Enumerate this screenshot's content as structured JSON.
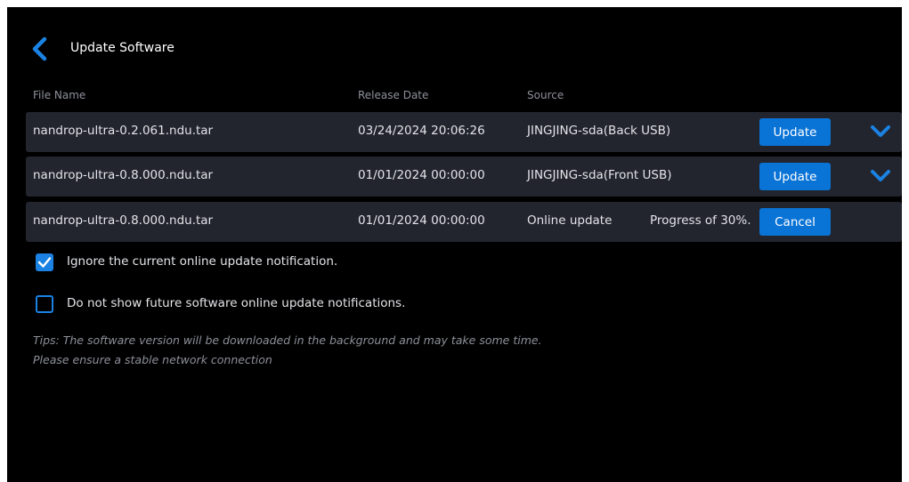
{
  "header": {
    "title": "Update Software",
    "back_icon": "chevron-left-icon"
  },
  "columns": {
    "file_name": "File Name",
    "release_date": "Release Date",
    "source": "Source"
  },
  "rows": [
    {
      "file_name": "nandrop-ultra-0.2.061.ndu.tar",
      "release_date": "03/24/2024 20:06:26",
      "source": "JINGJING-sda(Back USB)",
      "progress": "",
      "action_label": "Update",
      "expand_icon": "chevron-down-icon"
    },
    {
      "file_name": "nandrop-ultra-0.8.000.ndu.tar",
      "release_date": "01/01/2024 00:00:00",
      "source": "JINGJING-sda(Front USB)",
      "progress": "",
      "action_label": "Update",
      "expand_icon": "chevron-down-icon"
    },
    {
      "file_name": "nandrop-ultra-0.8.000.ndu.tar",
      "release_date": "01/01/2024 00:00:00",
      "source": "Online update",
      "progress": "Progress of 30%.",
      "progress_value": 0.3,
      "action_label": "Cancel"
    }
  ],
  "options": [
    {
      "label": "Ignore the current online update notification.",
      "checked": true
    },
    {
      "label": "Do not show future software online update notifications.",
      "checked": false
    }
  ],
  "tips": {
    "line1": "Tips: The software version will be downloaded in the background and may take some time.",
    "line2": "Please ensure a stable network connection"
  },
  "colors": {
    "background": "#000000",
    "row_background": "#22252e",
    "accent": "#0a73d6",
    "muted_text": "#8d9099"
  }
}
